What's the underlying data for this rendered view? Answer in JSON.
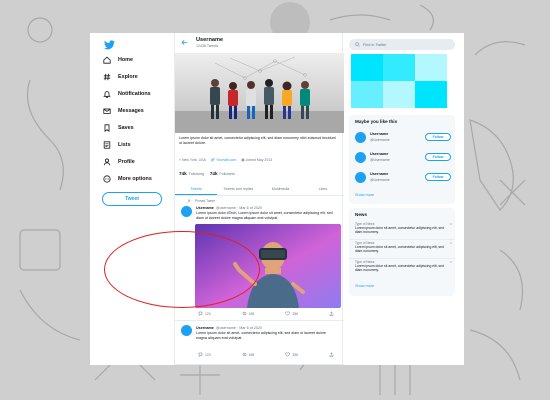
{
  "nav": {
    "items": [
      {
        "label": "Home",
        "icon": "home-icon"
      },
      {
        "label": "Explore",
        "icon": "hashtag-icon"
      },
      {
        "label": "Notifications",
        "icon": "bell-icon"
      },
      {
        "label": "Messages",
        "icon": "mail-icon"
      },
      {
        "label": "Saves",
        "icon": "bookmark-icon"
      },
      {
        "label": "Lists",
        "icon": "list-icon"
      },
      {
        "label": "Profile",
        "icon": "person-icon"
      },
      {
        "label": "More options",
        "icon": "more-icon"
      }
    ],
    "tweet_button": "Tweet"
  },
  "profile": {
    "username": "Username",
    "tweet_count": "12436 Tweets",
    "bio": "Lorem ipsum dolor sit amet, consectetur adipiscing elit, sed diam nonummy nibh euismod tincidunt ut laoreet dolore.",
    "location": "New York, USA",
    "website": "Yoursite.com",
    "joined": "Joined May 2013",
    "following_count": "74k",
    "following_label": "Following",
    "followers_count": "74k",
    "followers_label": "Followers"
  },
  "tabs": [
    "Tweets",
    "Tweets and replies",
    "Multimedia",
    "Likes"
  ],
  "tweets": [
    {
      "pinned_label": "Pinned Tweet",
      "name": "Username",
      "handle": "@username · Mar 6 of 2020",
      "body": "Lorem ipsum dolor #Tech. Lorem ipsum dolor sit amet, consectetur adipiscing elit, sed diam ut laoreet dolore magna aliquam erat volutpat.",
      "replies": "123",
      "retweets": "185",
      "likes": "256"
    },
    {
      "name": "Username",
      "handle": "@username · Mar 6 of 2020",
      "body": "Lorem ipsum dolor sit amet, consectetur adipiscing elit, sed diam ut laoreet dolore magna aliquam erat volutpat.",
      "replies": "123",
      "retweets": "185",
      "likes": "256"
    }
  ],
  "search": {
    "placeholder": "Find in Twitter"
  },
  "suggestions": {
    "title": "Maybe you like this",
    "items": [
      {
        "name": "Username",
        "handle": "@Username",
        "button": "Follow"
      },
      {
        "name": "Username",
        "handle": "@Username",
        "button": "Follow"
      },
      {
        "name": "Username",
        "handle": "@Username",
        "button": "Follow"
      }
    ],
    "show_more": "Show more"
  },
  "news": {
    "title": "News",
    "items": [
      {
        "type": "Type of News",
        "text": "Lorem ipsum dolor sit amet, consectetur adipiscing elit, sed diam nonummy."
      },
      {
        "type": "Type of News",
        "text": "Lorem ipsum dolor sit amet, consectetur adipiscing elit, sed diam nonummy."
      },
      {
        "type": "Type of News",
        "text": "Lorem ipsum dolor sit amet, consectetur adipiscing elit, sed diam nonummy."
      }
    ],
    "show_more": "Show more"
  },
  "colors": {
    "accent": "#1da1f2",
    "gallery_cyan": "#00e5ff",
    "highlight": "#e02020",
    "background": "#cfcfcf"
  }
}
